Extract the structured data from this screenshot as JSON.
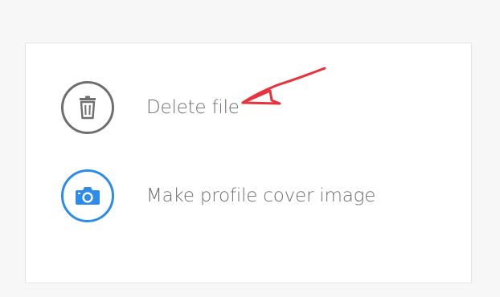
{
  "options": [
    {
      "label": "Delete file",
      "icon": "trash-icon",
      "color": "#6f6f6f"
    },
    {
      "label": "Make profile cover image",
      "icon": "camera-icon",
      "color": "#2d8ceb"
    }
  ],
  "annotation": {
    "type": "red-arrow",
    "color": "#e8323c"
  }
}
